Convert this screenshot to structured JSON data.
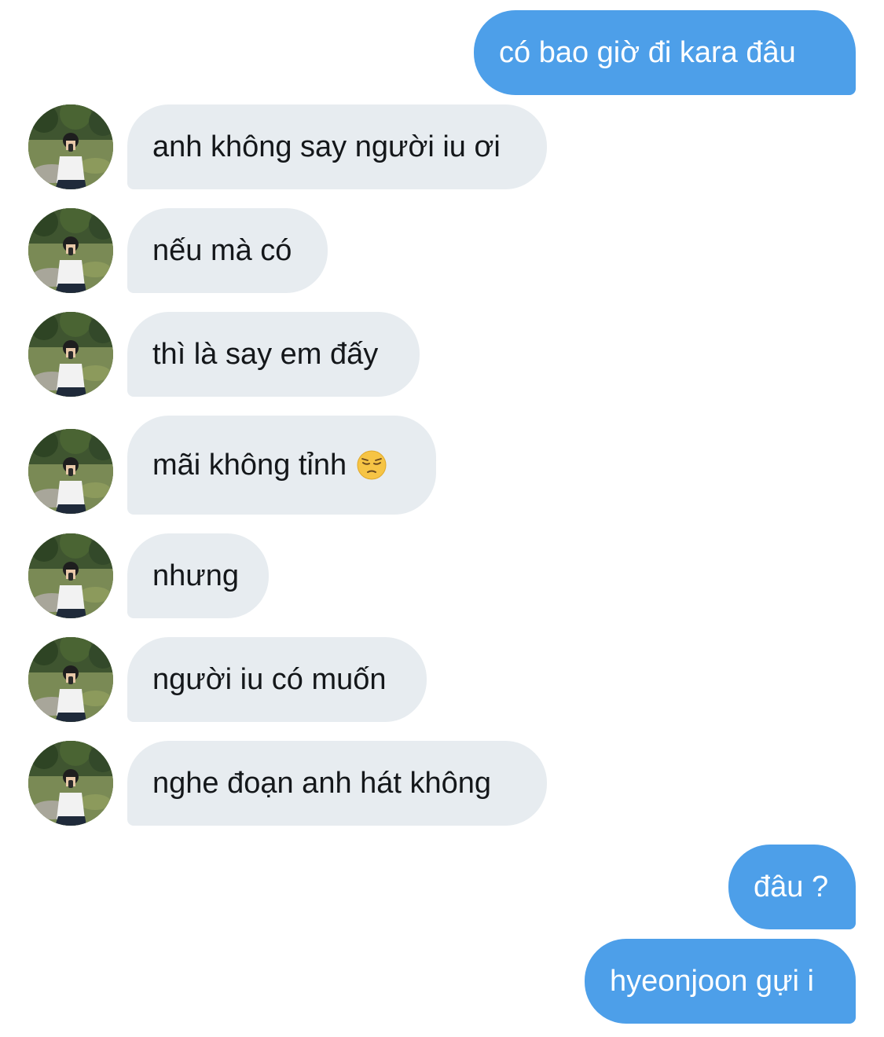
{
  "conversation": {
    "messages": [
      {
        "sender": "me",
        "text": "có bao giờ đi kara đâu"
      },
      {
        "sender": "other",
        "text": "anh không say người iu ơi"
      },
      {
        "sender": "other",
        "text": "nếu mà có"
      },
      {
        "sender": "other",
        "text": "thì là say em đấy"
      },
      {
        "sender": "other",
        "text": "mãi không tỉnh",
        "emoji": "pensive-face-icon"
      },
      {
        "sender": "other",
        "text": "nhưng"
      },
      {
        "sender": "other",
        "text": "người iu có muốn"
      },
      {
        "sender": "other",
        "text": "nghe đoạn anh hát không"
      },
      {
        "sender": "me",
        "text": "đâu ?"
      },
      {
        "sender": "me",
        "text": "hyeonjoon gựi i"
      }
    ]
  },
  "colors": {
    "sent_bubble": "#4d9fe9",
    "received_bubble": "#e7ecf0",
    "sent_text": "#ffffff",
    "received_text": "#14171a",
    "background": "#ffffff"
  },
  "icons": {
    "avatar": "contact-avatar-photo",
    "emoji": "pensive-face-icon"
  }
}
